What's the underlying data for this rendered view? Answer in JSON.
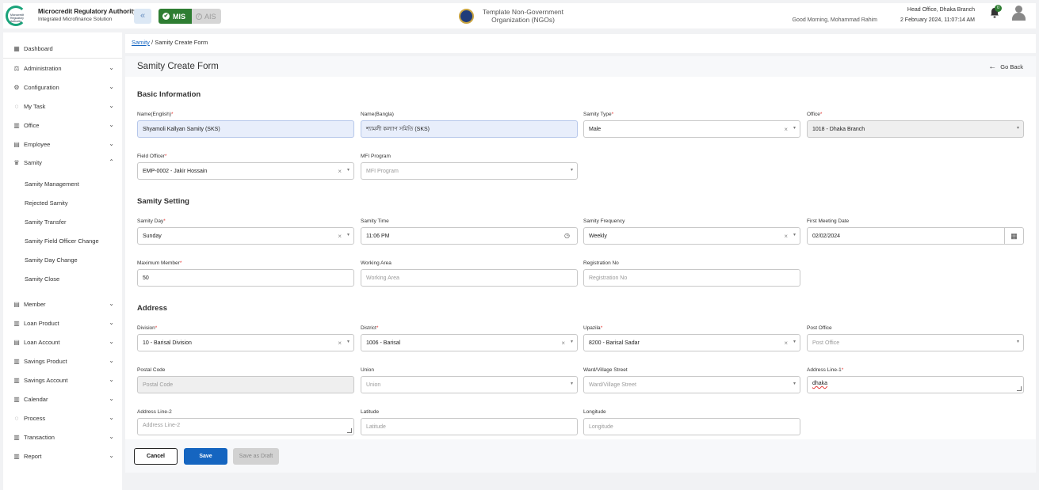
{
  "header": {
    "brand_title": "Microcredit Regulatory Authority",
    "brand_subtitle": "Integrated Microfinance Solution",
    "logo_text": "Microcredit Regulatory Authority",
    "collapse_icon": "«",
    "mis_label": "MIS",
    "ais_label": "AIS",
    "org_name": "Template Non-Government Organization (NGOs)",
    "greeting": "Good Morning, Mohammad Rahim",
    "office": "Head Office, Dhaka Branch",
    "datetime": "2 February 2024, 11:07:14 AM",
    "notification_count": "0"
  },
  "sidebar": {
    "dashboard": "Dashboard",
    "items": [
      {
        "label": "Administration",
        "icon": "admin-icon"
      },
      {
        "label": "Configuration",
        "icon": "config-icon"
      },
      {
        "label": "My Task",
        "icon": "task-icon"
      },
      {
        "label": "Office",
        "icon": "office-icon"
      },
      {
        "label": "Employee",
        "icon": "employee-icon"
      },
      {
        "label": "Samity",
        "icon": "samity-icon"
      }
    ],
    "samity_sub": [
      "Samity Management",
      "Rejected Samity",
      "Samity Transfer",
      "Samity Field Officer Change",
      "Samity Day Change",
      "Samity Close"
    ],
    "items_after": [
      "Member",
      "Loan Product",
      "Loan Account",
      "Savings Product",
      "Savings Account",
      "Calendar",
      "Process",
      "Transaction",
      "Report"
    ]
  },
  "breadcrumb": {
    "parent": "Samity",
    "separator": "/",
    "current": "Samity Create Form"
  },
  "page": {
    "title": "Samity Create Form",
    "go_back": "Go Back"
  },
  "sections": {
    "basic": "Basic Information",
    "setting": "Samity Setting",
    "address": "Address"
  },
  "fields": {
    "name_en": {
      "label": "Name(English)",
      "value": "Shyamoli Kallyan Samity (SKS)"
    },
    "name_bn": {
      "label": "Name(Bangla)",
      "value": "শ্যামলী কল্যাণ সমিতি (SKS)"
    },
    "samity_type": {
      "label": "Samity Type",
      "value": "Male"
    },
    "office": {
      "label": "Office",
      "value": "1018 - Dhaka Branch"
    },
    "field_officer": {
      "label": "Field Officer",
      "value": "EMP-0002 - Jakir Hossain"
    },
    "mfi_program": {
      "label": "MFI Program",
      "placeholder": "MFI Program"
    },
    "samity_day": {
      "label": "Samity Day",
      "value": "Sunday"
    },
    "samity_time": {
      "label": "Samity Time",
      "value": "11:06 PM"
    },
    "samity_frequency": {
      "label": "Samity Frequency",
      "value": "Weekly"
    },
    "first_meeting": {
      "label": "First Meeting Date",
      "value": "02/02/2024"
    },
    "max_member": {
      "label": "Maximum Member",
      "value": "50"
    },
    "working_area": {
      "label": "Working Area",
      "placeholder": "Working Area"
    },
    "registration_no": {
      "label": "Registration No",
      "placeholder": "Registration No"
    },
    "division": {
      "label": "Division",
      "value": "10 - Barisal Division"
    },
    "district": {
      "label": "District",
      "value": "1006 - Barisal"
    },
    "upazila": {
      "label": "Upazila",
      "value": "8200 - Barisal Sadar"
    },
    "post_office": {
      "label": "Post Office",
      "placeholder": "Post Office"
    },
    "postal_code": {
      "label": "Postal Code",
      "placeholder": "Postal Code"
    },
    "union": {
      "label": "Union",
      "placeholder": "Union"
    },
    "ward": {
      "label": "Ward/Village Street",
      "placeholder": "Ward/Village Street"
    },
    "address1": {
      "label": "Address Line-1",
      "value": "dhaka"
    },
    "address2": {
      "label": "Address Line-2",
      "placeholder": "Address Line-2"
    },
    "latitude": {
      "label": "Latitude",
      "placeholder": "Latitude"
    },
    "longitude": {
      "label": "Longitude",
      "placeholder": "Longitude"
    }
  },
  "buttons": {
    "cancel": "Cancel",
    "save": "Save",
    "draft": "Save as Draft"
  },
  "colors": {
    "primary": "#1565c0",
    "mis_green": "#2e7d32",
    "required": "#e53935"
  }
}
